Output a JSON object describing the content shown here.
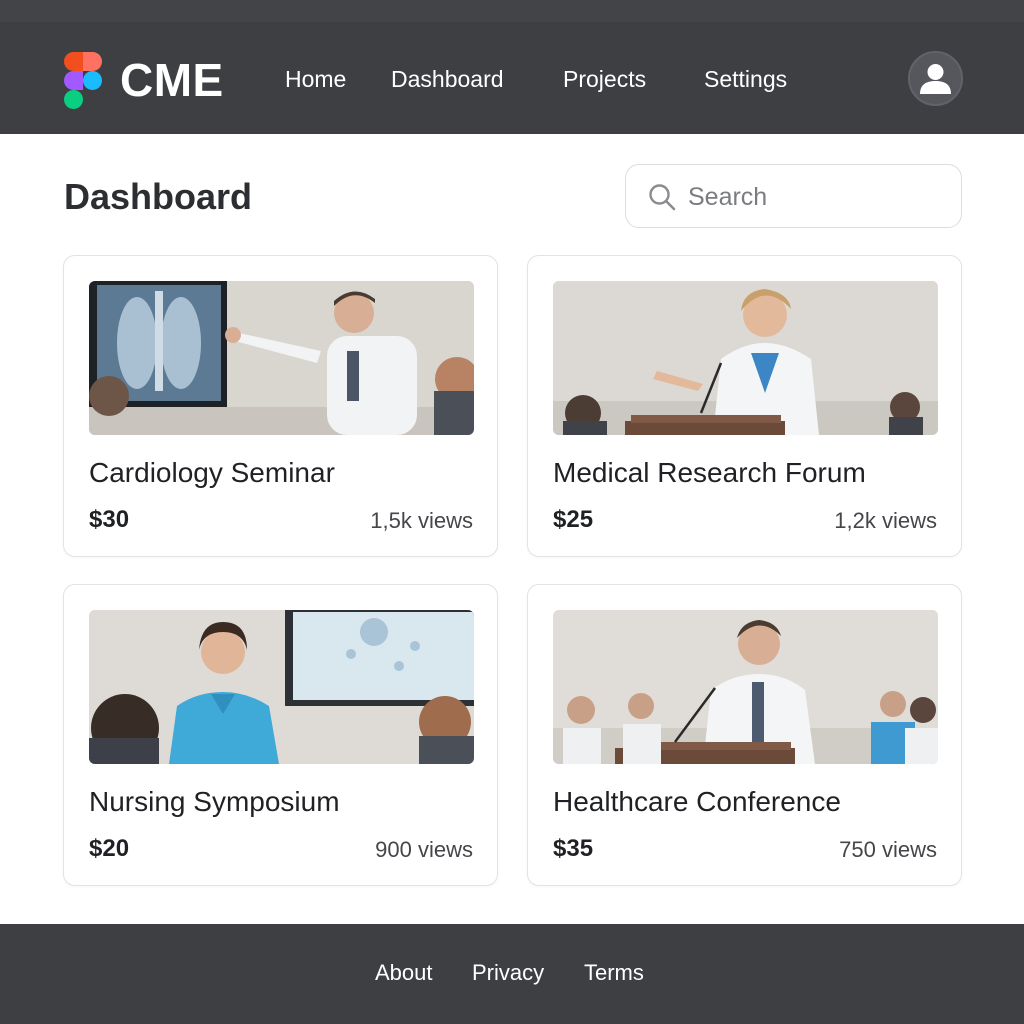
{
  "header": {
    "brand": "CME",
    "nav": [
      {
        "label": "Home"
      },
      {
        "label": "Dashboard"
      },
      {
        "label": "Projects"
      },
      {
        "label": "Settings"
      }
    ],
    "logo_colors": [
      "#f24e1e",
      "#a259ff",
      "#1abcfe",
      "#0acf83",
      "#ff7262"
    ],
    "avatar_icon": "user-icon"
  },
  "main": {
    "title": "Dashboard",
    "search": {
      "placeholder": "Search",
      "value": "",
      "icon": "search-icon"
    }
  },
  "cards": [
    {
      "title": "Cardiology Seminar",
      "price": "$30",
      "views": "1,5k views"
    },
    {
      "title": "Medical Research Forum",
      "price": "$25",
      "views": "1,2k views"
    },
    {
      "title": "Nursing Symposium",
      "price": "$20",
      "views": "900 views"
    },
    {
      "title": "Healthcare Conference",
      "price": "$35",
      "views": "750 views"
    }
  ],
  "footer": {
    "links": [
      {
        "label": "About"
      },
      {
        "label": "Privacy"
      },
      {
        "label": "Terms"
      }
    ]
  },
  "colors": {
    "nav_background": "#3e3f43",
    "page_background": "#ffffff",
    "text_primary": "#1f2124"
  }
}
